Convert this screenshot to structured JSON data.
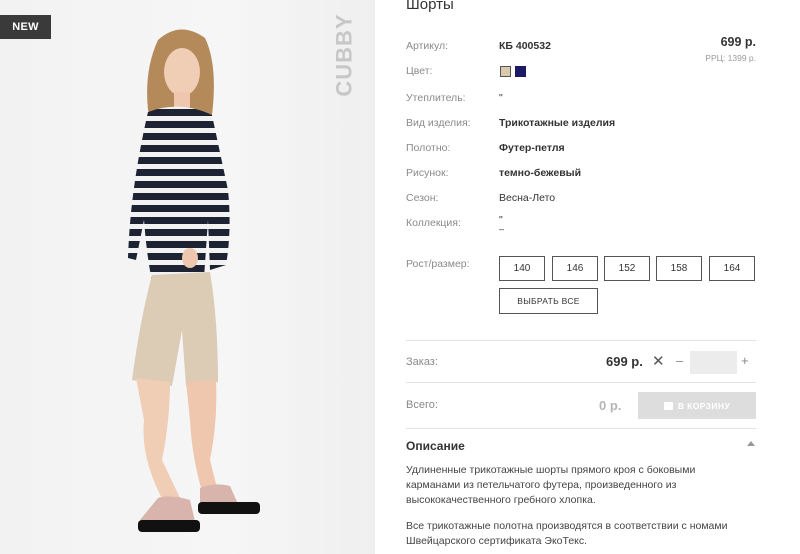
{
  "badge": "NEW",
  "brand": "CUBBY",
  "product": {
    "title": "Шорты",
    "price": "699 р.",
    "rrp": "РРЦ: 1399 р."
  },
  "attributes": {
    "article_label": "Артикул:",
    "article_value": "КБ 400532",
    "color_label": "Цвет:",
    "swatch_colors": [
      "#d9c9ad",
      "#1c1a66"
    ],
    "insulation_label": "Утеплитель:",
    "insulation_value": "\"",
    "type_label": "Вид изделия:",
    "type_value": "Трикотажные изделия",
    "fabric_label": "Полотно:",
    "fabric_value": "Футер-петля",
    "pattern_label": "Рисунок:",
    "pattern_value": "темно-бежевый",
    "season_label": "Сезон:",
    "season_value": "Весна-Лето",
    "collection_label": "Коллекция:",
    "collection_value": "\"",
    "collection_value2": "–",
    "size_label": "Рост/размер:"
  },
  "sizes": [
    "140",
    "146",
    "152",
    "158",
    "164"
  ],
  "select_all": "ВЫБРАТЬ ВСЕ",
  "order": {
    "label": "Заказ:",
    "price": "699 р.",
    "times": "✕",
    "minus": "–",
    "plus": "+",
    "quantity": ""
  },
  "total": {
    "label": "Всего:",
    "value": "0 р.",
    "cart_button": "В КОРЗИНУ"
  },
  "description": {
    "title": "Описание",
    "p1_line1": "Удлиненные трикотажные шорты прямого кроя с боковыми",
    "p1_line2": "карманами из петельчатого футера, произведенного из",
    "p1_line3": "высококачественного гребного хлопка.",
    "p2_line1": "Все трикотажные полотна производятся в соответствии с номами",
    "p2_line2": "Швейцарского сертификата ЭкоТекс."
  }
}
